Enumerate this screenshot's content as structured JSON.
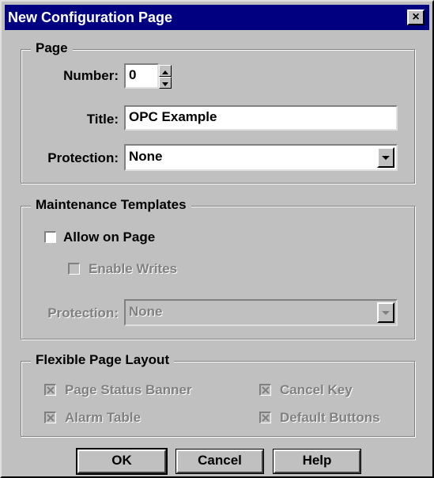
{
  "window": {
    "title": "New Configuration Page",
    "close_glyph": "×"
  },
  "page_group": {
    "legend": "Page",
    "number_label": "Number:",
    "number_value": "0",
    "title_label": "Title:",
    "title_value": "OPC Example",
    "protection_label": "Protection:",
    "protection_value": "None"
  },
  "maintenance_group": {
    "legend": "Maintenance Templates",
    "allow_on_page_label": "Allow on Page",
    "allow_on_page_checked": false,
    "enable_writes_label": "Enable Writes",
    "enable_writes_checked": false,
    "protection_label": "Protection:",
    "protection_value": "None"
  },
  "layout_group": {
    "legend": "Flexible Page Layout",
    "items": [
      {
        "label": "Page Status Banner",
        "checked": true
      },
      {
        "label": "Cancel Key",
        "checked": true
      },
      {
        "label": "Alarm Table",
        "checked": true
      },
      {
        "label": "Default Buttons",
        "checked": true
      }
    ]
  },
  "buttons": {
    "ok": "OK",
    "cancel": "Cancel",
    "help": "Help"
  },
  "colors": {
    "titlebar": "#000080",
    "face": "#c0c0c0",
    "disabled_text": "#808080"
  }
}
